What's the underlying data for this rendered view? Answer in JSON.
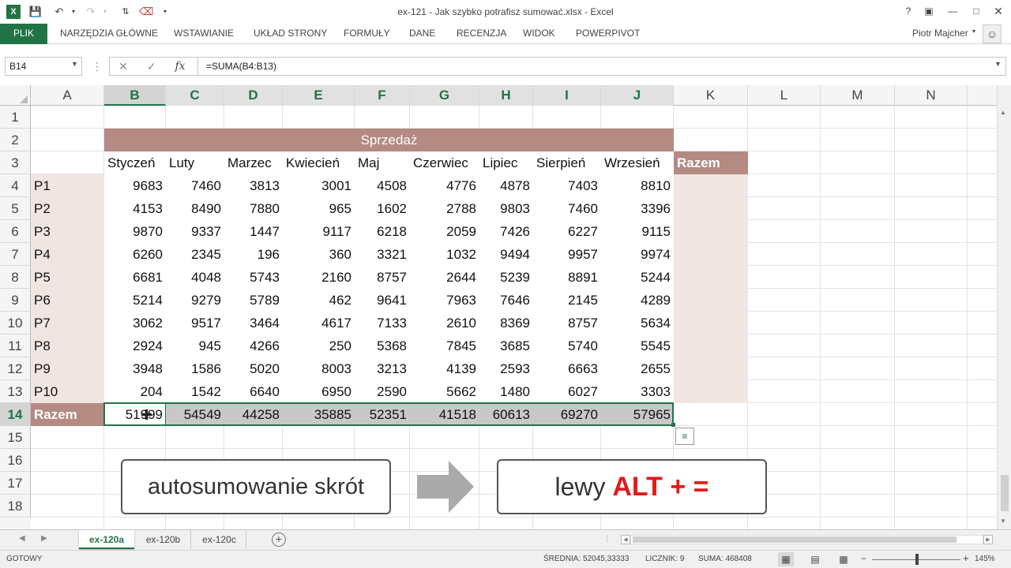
{
  "window": {
    "title": "ex-121 - Jak szybko potrafisz sumować.xlsx - Excel",
    "user": "Piotr Majcher"
  },
  "ribbon": {
    "tabs": [
      "PLIK",
      "NARZĘDZIA GŁÓWNE",
      "WSTAWIANIE",
      "UKŁAD STRONY",
      "FORMUŁY",
      "DANE",
      "RECENZJA",
      "WIDOK",
      "POWERPIVOT"
    ]
  },
  "formula_bar": {
    "name_box": "B14",
    "fx_label": "fx",
    "formula": "=SUMA(B4:B13)"
  },
  "grid": {
    "columns": [
      "A",
      "B",
      "C",
      "D",
      "E",
      "F",
      "G",
      "H",
      "I",
      "J",
      "K",
      "L",
      "M",
      "N"
    ],
    "rows": [
      "1",
      "2",
      "3",
      "4",
      "5",
      "6",
      "7",
      "8",
      "9",
      "10",
      "11",
      "12",
      "13",
      "14",
      "15",
      "16",
      "17",
      "18"
    ],
    "selected_column": "B",
    "selected_row": "14"
  },
  "table": {
    "title": "Sprzedaż",
    "total_header": "Razem",
    "months": [
      "Styczeń",
      "Luty",
      "Marzec",
      "Kwiecień",
      "Maj",
      "Czerwiec",
      "Lipiec",
      "Sierpień",
      "Wrzesień"
    ],
    "rows": [
      {
        "label": "P1",
        "values": [
          "9683",
          "7460",
          "3813",
          "3001",
          "4508",
          "4776",
          "4878",
          "7403",
          "8810"
        ]
      },
      {
        "label": "P2",
        "values": [
          "4153",
          "8490",
          "7880",
          "965",
          "1602",
          "2788",
          "9803",
          "7460",
          "3396"
        ]
      },
      {
        "label": "P3",
        "values": [
          "9870",
          "9337",
          "1447",
          "9117",
          "6218",
          "2059",
          "7426",
          "6227",
          "9115"
        ]
      },
      {
        "label": "P4",
        "values": [
          "6260",
          "2345",
          "196",
          "360",
          "3321",
          "1032",
          "9494",
          "9957",
          "9974"
        ]
      },
      {
        "label": "P5",
        "values": [
          "6681",
          "4048",
          "5743",
          "2160",
          "8757",
          "2644",
          "5239",
          "8891",
          "5244"
        ]
      },
      {
        "label": "P6",
        "values": [
          "5214",
          "9279",
          "5789",
          "462",
          "9641",
          "7963",
          "7646",
          "2145",
          "4289"
        ]
      },
      {
        "label": "P7",
        "values": [
          "3062",
          "9517",
          "3464",
          "4617",
          "7133",
          "2610",
          "8369",
          "8757",
          "5634"
        ]
      },
      {
        "label": "P8",
        "values": [
          "2924",
          "945",
          "4266",
          "250",
          "5368",
          "7845",
          "3685",
          "5740",
          "5545"
        ]
      },
      {
        "label": "P9",
        "values": [
          "3948",
          "1586",
          "5020",
          "8003",
          "3213",
          "4139",
          "2593",
          "6663",
          "2655"
        ]
      },
      {
        "label": "P10",
        "values": [
          "204",
          "1542",
          "6640",
          "6950",
          "2590",
          "5662",
          "1480",
          "6027",
          "3303"
        ]
      }
    ],
    "totals_label": "Razem",
    "totals": [
      "51999",
      "54549",
      "44258",
      "35885",
      "52351",
      "41518",
      "60613",
      "69270",
      "57965"
    ]
  },
  "annotation": {
    "left_text": "autosumowanie skrót",
    "right_plain": "lewy ",
    "right_bold": "ALT + ="
  },
  "sheets": {
    "tabs": [
      "ex-120a",
      "ex-120b",
      "ex-120c"
    ],
    "active": "ex-120a"
  },
  "status": {
    "mode": "GOTOWY",
    "average": "ŚREDNIA: 52045,33333",
    "count": "LICZNIK: 9",
    "sum": "SUMA: 468408",
    "zoom": "145%"
  },
  "colors": {
    "excel_green": "#217346",
    "table_header": "#b48a82",
    "table_light": "#f1e5e2",
    "selection_gray": "#c8c8c8",
    "accent_red": "#e11b1b"
  }
}
